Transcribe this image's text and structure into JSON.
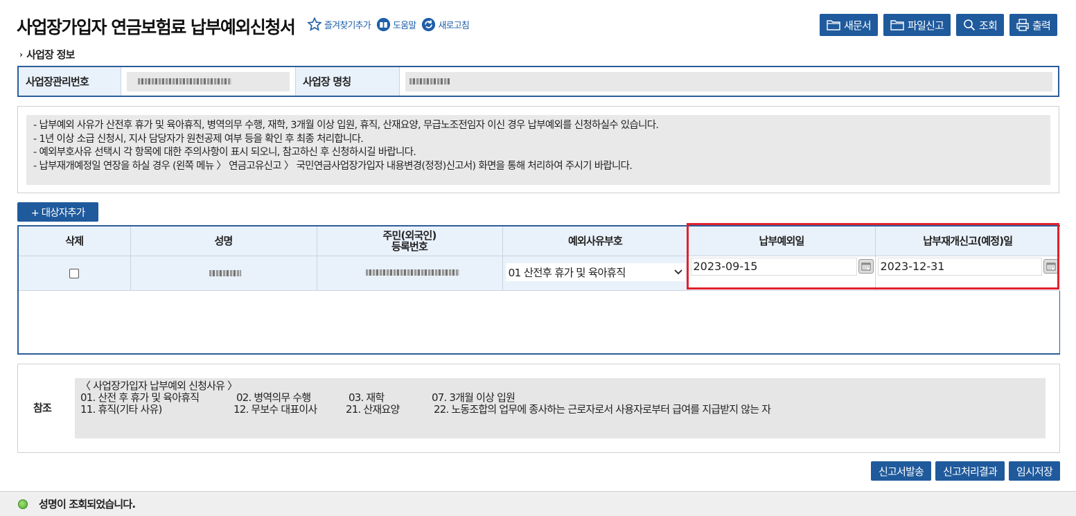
{
  "header": {
    "title": "사업장가입자 연금보험료 납부예외신청서",
    "links": {
      "bookmark": "즐겨찾기추가",
      "help": "도움말",
      "refresh": "새로고침"
    },
    "buttons": {
      "new_doc": "새문서",
      "file_report": "파일신고",
      "search": "조회",
      "print": "출력"
    }
  },
  "workplace": {
    "section_title": "사업장 정보",
    "mgmt_no_label": "사업장관리번호",
    "mgmt_no_value": "",
    "name_label": "사업장 명칭",
    "name_value": ""
  },
  "notice": {
    "lines": [
      "- 납부예외 사유가 산전후 휴가 및 육아휴직, 병역의무 수행, 재학, 3개월 이상 입원, 휴직, 산재요양, 무급노조전임자 이신 경우 납부예외를 신청하실수 있습니다.",
      "- 1년 이상 소급 신청시, 지사 담당자가 원천공제 여부 등을 확인 후 최종 처리합니다.",
      "- 예외부호사유 선택시 각 항목에 대한 주의사항이 표시 되오니, 참고하신 후 신청하시길 바랍니다.",
      "- 납부재개예정일 연장을 하실 경우 (왼쪽 메뉴 〉 연금고유신고 〉 국민연금사업장가입자 내용변경(정정)신고서) 화면을 통해 처리하여 주시기 바랍니다."
    ]
  },
  "add_button": "+ 대상자추가",
  "grid": {
    "headers": {
      "delete": "삭제",
      "name": "성명",
      "resident_no_line1": "주민(외국인)",
      "resident_no_line2": "등록번호",
      "reason_code": "예외사유부호",
      "exempt_date": "납부예외일",
      "resume_date": "납부재개신고(예정)일"
    },
    "rows": [
      {
        "checked": false,
        "name": "",
        "resident_no": "",
        "reason": "01 산전후 휴가 및 육아휴직",
        "exempt_date": "2023-09-15",
        "resume_date": "2023-12-31"
      }
    ]
  },
  "reference": {
    "label": "참조",
    "title": "〈 사업장가입자 납부예외 신청사유 〉",
    "row1": [
      "01. 산전 후 휴가 및 육아휴직",
      "02. 병역의무 수행",
      "03. 재학",
      "07. 3개월 이상 입원"
    ],
    "row2": [
      "11. 휴직(기타 사유)",
      "12. 무보수 대표이사",
      "21. 산재요양",
      "22. 노동조합의 업무에 종사하는 근로자로서 사용자로부터 급여를 지급받지 않는 자"
    ]
  },
  "bottom_buttons": {
    "submit": "신고서발송",
    "result": "신고처리결과",
    "temp_save": "임시저장"
  },
  "status": {
    "message": "성명이 조회되었습니다."
  },
  "colors": {
    "primary": "#1f5a9c",
    "highlight": "#e0202c",
    "header_bg": "#e9f1fa"
  }
}
